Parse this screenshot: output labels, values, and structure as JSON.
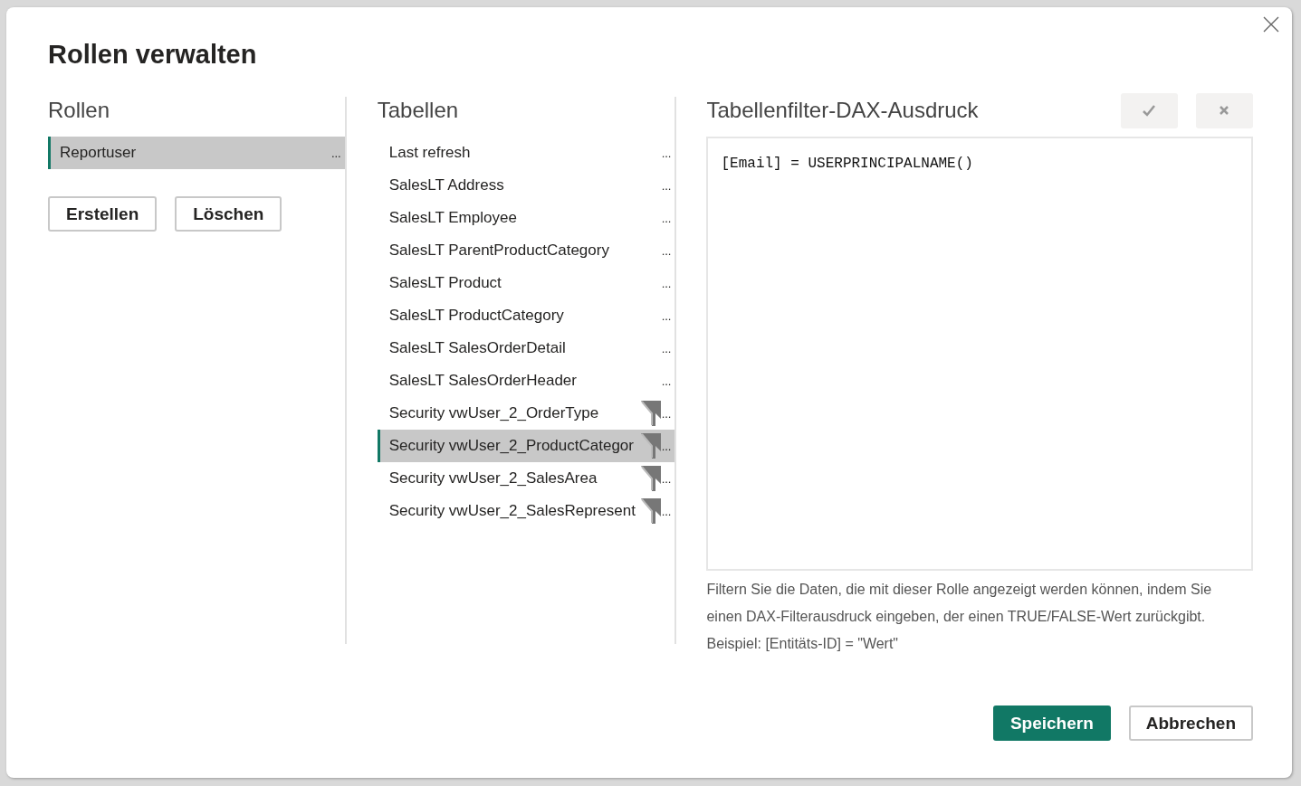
{
  "dialog": {
    "title": "Rollen verwalten"
  },
  "roles": {
    "heading": "Rollen",
    "items": [
      {
        "name": "Reportuser",
        "more": "...",
        "selected": true
      }
    ],
    "buttons": [
      "Erstellen",
      "Löschen"
    ]
  },
  "tables": {
    "heading": "Tabellen",
    "items": [
      {
        "name": "Last refresh",
        "more": "...",
        "filtered": false,
        "selected": false
      },
      {
        "name": "SalesLT Address",
        "more": "...",
        "filtered": false,
        "selected": false
      },
      {
        "name": "SalesLT Employee",
        "more": "...",
        "filtered": false,
        "selected": false
      },
      {
        "name": "SalesLT ParentProductCategory",
        "more": "...",
        "filtered": false,
        "selected": false
      },
      {
        "name": "SalesLT Product",
        "more": "...",
        "filtered": false,
        "selected": false
      },
      {
        "name": "SalesLT ProductCategory",
        "more": "...",
        "filtered": false,
        "selected": false
      },
      {
        "name": "SalesLT SalesOrderDetail",
        "more": "...",
        "filtered": false,
        "selected": false
      },
      {
        "name": "SalesLT SalesOrderHeader",
        "more": "...",
        "filtered": false,
        "selected": false
      },
      {
        "name": "Security vwUser_2_OrderType",
        "more": "...",
        "filtered": true,
        "selected": false
      },
      {
        "name": "Security vwUser_2_ProductCategor",
        "more": "...",
        "filtered": true,
        "selected": true
      },
      {
        "name": "Security vwUser_2_SalesArea",
        "more": "...",
        "filtered": true,
        "selected": false
      },
      {
        "name": "Security vwUser_2_SalesRepresent",
        "more": "...",
        "filtered": true,
        "selected": false
      }
    ]
  },
  "dax": {
    "heading": "Tabellenfilter-DAX-Ausdruck",
    "expression": "[Email] = USERPRINCIPALNAME()",
    "help": "Filtern Sie die Daten, die mit dieser Rolle angezeigt werden können, indem Sie einen DAX-Filterausdruck eingeben, der einen TRUE/FALSE-Wert zurückgibt. Beispiel: [Entitäts-ID] = \"Wert\""
  },
  "footer": {
    "primary": "Speichern",
    "secondary": "Abbrechen"
  }
}
